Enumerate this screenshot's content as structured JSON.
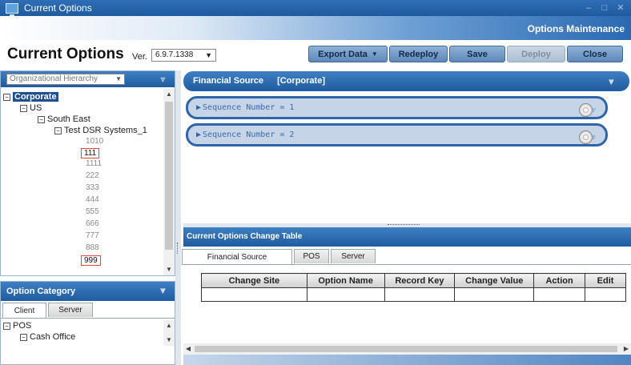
{
  "window": {
    "title": "Current Options",
    "min": "–",
    "max": "□",
    "close": "✕"
  },
  "banner": {
    "title": "Options Maintenance"
  },
  "page": {
    "title": "Current Options",
    "ver_label": "Ver.",
    "version": "6.9.7.1338"
  },
  "toolbar": {
    "export": "Export Data",
    "redeploy": "Redeploy",
    "save": "Save",
    "deploy": "Deploy",
    "close": "Close"
  },
  "hierarchy": {
    "select": "Organizational Hierarchy",
    "root": "Corporate",
    "us": "US",
    "south_east": "South East",
    "test_dsr": "Test DSR Systems_1",
    "leaves": [
      "1010",
      "111",
      "1111",
      "222",
      "333",
      "444",
      "555",
      "666",
      "777",
      "888",
      "999"
    ]
  },
  "option_category": {
    "title": "Option Category",
    "tabs": [
      "Client",
      "Server"
    ],
    "tree": {
      "pos": "POS",
      "cash_office": "Cash Office"
    }
  },
  "financial_source": {
    "title": "Financial Source",
    "scope": "[Corporate]",
    "sequences": [
      "Sequence Number = 1",
      "Sequence Number = 2"
    ]
  },
  "change_table": {
    "title": "Current Options Change Table",
    "tabs": [
      "Financial Source",
      "POS",
      "Server"
    ],
    "columns": [
      "Change Site",
      "Option Name",
      "Record Key",
      "Change Value",
      "Action",
      "Edit"
    ]
  }
}
